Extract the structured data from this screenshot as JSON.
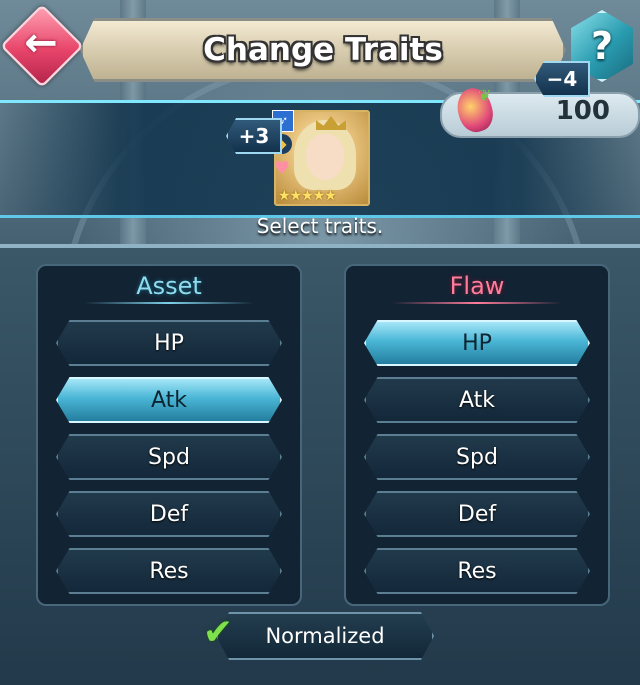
{
  "header": {
    "title": "Change Traits",
    "help_label": "?"
  },
  "hero": {
    "rarity_stars": "★★★★★",
    "weapon_icon": "bow-icon",
    "movement_icon": "flier-icon"
  },
  "currency": {
    "icon": "dew-fruit-icon",
    "amount": "100"
  },
  "instruction": "Select traits.",
  "asset": {
    "title": "Asset",
    "stats": [
      "HP",
      "Atk",
      "Spd",
      "Def",
      "Res"
    ],
    "selected": "Atk",
    "modifier": "+3"
  },
  "flaw": {
    "title": "Flaw",
    "stats": [
      "HP",
      "Atk",
      "Spd",
      "Def",
      "Res"
    ],
    "selected": "HP",
    "modifier": "−4"
  },
  "normalized": {
    "label": "Normalized",
    "checked": true
  },
  "colors": {
    "asset_title": "#8fdcf0",
    "flaw_title": "#ff7c9a",
    "active_button": "#4ab6d6",
    "check": "#7ee04a"
  }
}
